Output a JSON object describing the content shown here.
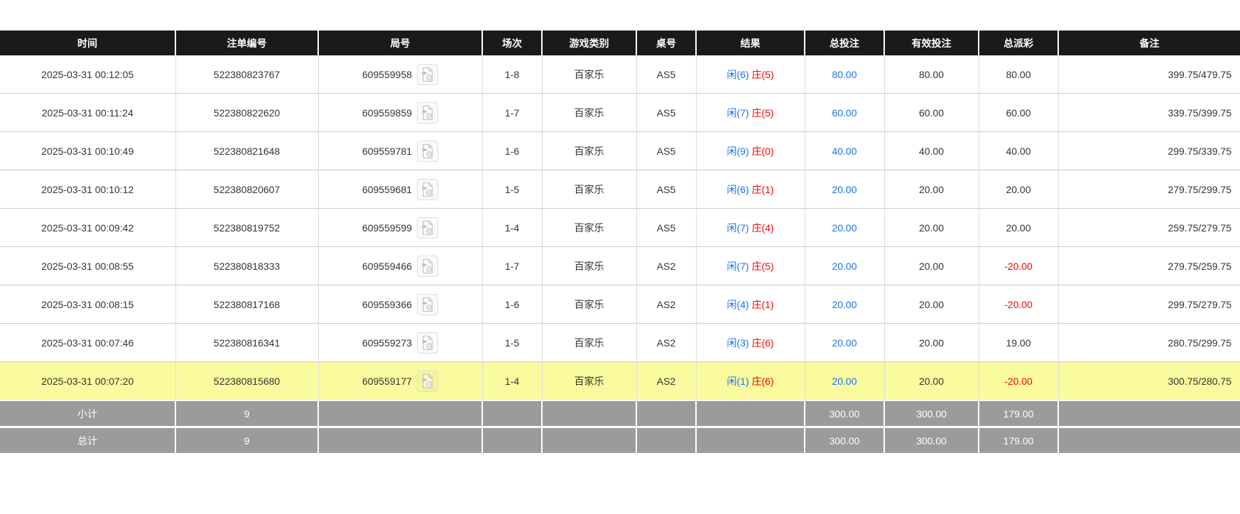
{
  "columns": [
    {
      "label": "时间"
    },
    {
      "label": "注单编号"
    },
    {
      "label": "局号"
    },
    {
      "label": "场次"
    },
    {
      "label": "游戏类别"
    },
    {
      "label": "桌号"
    },
    {
      "label": "结果"
    },
    {
      "label": "总投注"
    },
    {
      "label": "有效投注"
    },
    {
      "label": "总派彩"
    },
    {
      "label": "备注"
    }
  ],
  "rows": [
    {
      "time": "2025-03-31 00:12:05",
      "bet_id": "522380823767",
      "round_id": "609559958",
      "session": "1-8",
      "game_type": "百家乐",
      "table_id": "AS5",
      "result_player": "闲(6)",
      "result_banker": "庄(5)",
      "total_bet": "80.00",
      "valid_bet": "80.00",
      "payout": "80.00",
      "remark": "399.75/479.75",
      "highlighted": false
    },
    {
      "time": "2025-03-31 00:11:24",
      "bet_id": "522380822620",
      "round_id": "609559859",
      "session": "1-7",
      "game_type": "百家乐",
      "table_id": "AS5",
      "result_player": "闲(7)",
      "result_banker": "庄(5)",
      "total_bet": "60.00",
      "valid_bet": "60.00",
      "payout": "60.00",
      "remark": "339.75/399.75",
      "highlighted": false
    },
    {
      "time": "2025-03-31 00:10:49",
      "bet_id": "522380821648",
      "round_id": "609559781",
      "session": "1-6",
      "game_type": "百家乐",
      "table_id": "AS5",
      "result_player": "闲(9)",
      "result_banker": "庄(0)",
      "total_bet": "40.00",
      "valid_bet": "40.00",
      "payout": "40.00",
      "remark": "299.75/339.75",
      "highlighted": false
    },
    {
      "time": "2025-03-31 00:10:12",
      "bet_id": "522380820607",
      "round_id": "609559681",
      "session": "1-5",
      "game_type": "百家乐",
      "table_id": "AS5",
      "result_player": "闲(6)",
      "result_banker": "庄(1)",
      "total_bet": "20.00",
      "valid_bet": "20.00",
      "payout": "20.00",
      "remark": "279.75/299.75",
      "highlighted": false
    },
    {
      "time": "2025-03-31 00:09:42",
      "bet_id": "522380819752",
      "round_id": "609559599",
      "session": "1-4",
      "game_type": "百家乐",
      "table_id": "AS5",
      "result_player": "闲(7)",
      "result_banker": "庄(4)",
      "total_bet": "20.00",
      "valid_bet": "20.00",
      "payout": "20.00",
      "remark": "259.75/279.75",
      "highlighted": false
    },
    {
      "time": "2025-03-31 00:08:55",
      "bet_id": "522380818333",
      "round_id": "609559466",
      "session": "1-7",
      "game_type": "百家乐",
      "table_id": "AS2",
      "result_player": "闲(7)",
      "result_banker": "庄(5)",
      "total_bet": "20.00",
      "valid_bet": "20.00",
      "payout": "-20.00",
      "remark": "279.75/259.75",
      "highlighted": false
    },
    {
      "time": "2025-03-31 00:08:15",
      "bet_id": "522380817168",
      "round_id": "609559366",
      "session": "1-6",
      "game_type": "百家乐",
      "table_id": "AS2",
      "result_player": "闲(4)",
      "result_banker": "庄(1)",
      "total_bet": "20.00",
      "valid_bet": "20.00",
      "payout": "-20.00",
      "remark": "299.75/279.75",
      "highlighted": false
    },
    {
      "time": "2025-03-31 00:07:46",
      "bet_id": "522380816341",
      "round_id": "609559273",
      "session": "1-5",
      "game_type": "百家乐",
      "table_id": "AS2",
      "result_player": "闲(3)",
      "result_banker": "庄(6)",
      "total_bet": "20.00",
      "valid_bet": "20.00",
      "payout": "19.00",
      "remark": "280.75/299.75",
      "highlighted": false
    },
    {
      "time": "2025-03-31 00:07:20",
      "bet_id": "522380815680",
      "round_id": "609559177",
      "session": "1-4",
      "game_type": "百家乐",
      "table_id": "AS2",
      "result_player": "闲(1)",
      "result_banker": "庄(6)",
      "total_bet": "20.00",
      "valid_bet": "20.00",
      "payout": "-20.00",
      "remark": "300.75/280.75",
      "highlighted": true
    }
  ],
  "footer": [
    {
      "label": "小计",
      "count": "9",
      "total_bet": "300.00",
      "valid_bet": "300.00",
      "payout": "179.00"
    },
    {
      "label": "总计",
      "count": "9",
      "total_bet": "300.00",
      "valid_bet": "300.00",
      "payout": "179.00"
    }
  ],
  "colors": {
    "header_bg": "#1a1a1a",
    "header_text": "#ffffff",
    "row_text": "#333333",
    "player_blue": "#1673f0",
    "banker_red": "#ff0000",
    "negative_red": "#ff0000",
    "selected_row_bg": "#fafa9e",
    "footer_bg": "#9b9b9b",
    "grid_border": "#cccccc"
  },
  "icons": {
    "round_video": "video-replay-icon"
  }
}
